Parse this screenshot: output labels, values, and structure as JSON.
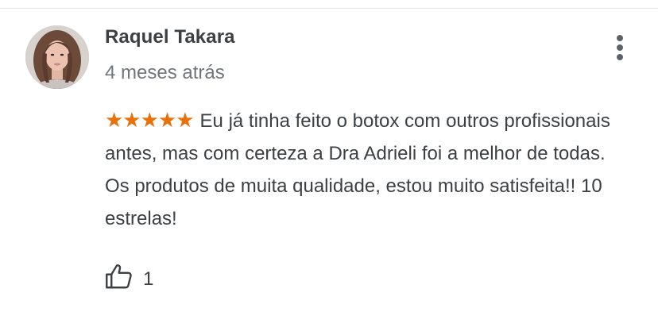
{
  "review": {
    "author_name": "Raquel Takara",
    "time": "4 meses atrás",
    "rating_stars": "★★★★★",
    "rating": 5,
    "text": "Eu já tinha feito o botox com outros profissionais antes, mas com certeza a Dra Adrieli foi a melhor de todas. Os produtos de muita qualidade, estou muito satisfeita!! 10 estrelas!",
    "like_count": "1",
    "star_color": "#e8710a"
  },
  "icons": {
    "more": "more-vert-icon",
    "like": "thumb-up-icon"
  }
}
